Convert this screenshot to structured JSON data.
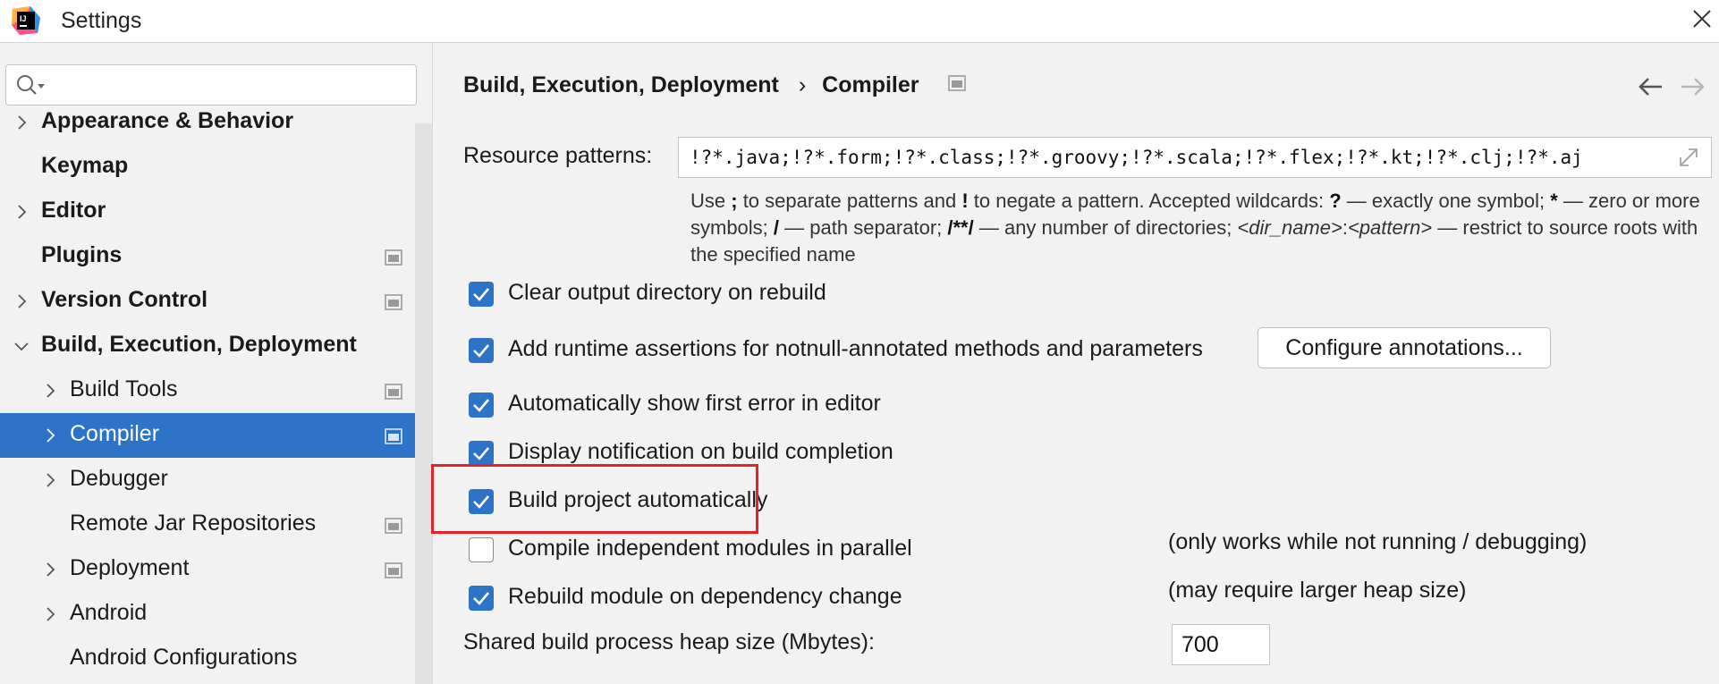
{
  "window": {
    "title": "Settings",
    "app_icon": "intellij-idea-icon",
    "close_icon": "close-icon"
  },
  "search": {
    "value": "",
    "placeholder": ""
  },
  "sidebar": {
    "items": [
      {
        "label": "Appearance & Behavior",
        "bold": true,
        "chevron": "right",
        "project_icon": false
      },
      {
        "label": "Keymap",
        "bold": true,
        "chevron": "none",
        "project_icon": false
      },
      {
        "label": "Editor",
        "bold": true,
        "chevron": "right",
        "project_icon": false
      },
      {
        "label": "Plugins",
        "bold": true,
        "chevron": "none",
        "project_icon": true
      },
      {
        "label": "Version Control",
        "bold": true,
        "chevron": "right",
        "project_icon": true
      },
      {
        "label": "Build, Execution, Deployment",
        "bold": true,
        "chevron": "down",
        "project_icon": false
      },
      {
        "label": "Build Tools",
        "bold": false,
        "chevron": "right",
        "project_icon": true
      },
      {
        "label": "Compiler",
        "bold": false,
        "chevron": "right",
        "project_icon": true,
        "selected": true
      },
      {
        "label": "Debugger",
        "bold": false,
        "chevron": "right",
        "project_icon": false
      },
      {
        "label": "Remote Jar Repositories",
        "bold": false,
        "chevron": "none",
        "project_icon": true
      },
      {
        "label": "Deployment",
        "bold": false,
        "chevron": "right",
        "project_icon": true
      },
      {
        "label": "Android",
        "bold": false,
        "chevron": "right",
        "project_icon": false
      },
      {
        "label": "Android Configurations",
        "bold": false,
        "chevron": "none",
        "project_icon": false
      }
    ]
  },
  "breadcrumb": {
    "parent": "Build, Execution, Deployment",
    "separator": "›",
    "current": "Compiler"
  },
  "resource_patterns": {
    "label": "Resource patterns:",
    "value": "!?*.java;!?*.form;!?*.class;!?*.groovy;!?*.scala;!?*.flex;!?*.kt;!?*.clj;!?*.aj"
  },
  "hint": {
    "t1": "Use ",
    "semi": ";",
    "t2": " to separate patterns and ",
    "bang": "!",
    "t3": " to negate a pattern. Accepted wildcards: ",
    "q": "?",
    "t4": " — exactly one symbol; ",
    "star": "*",
    "t5": " — zero or more symbols; ",
    "slash": "/",
    "t6": " — path separator; ",
    "dstar": "/**/",
    "t7": " — any number of directories; ",
    "dir": "<dir_name>",
    "colon": ":",
    "pat": "<pattern>",
    "t8": " — restrict to source roots with the specified name"
  },
  "options": [
    {
      "label": "Clear output directory on rebuild",
      "checked": true
    },
    {
      "label": "Add runtime assertions for notnull-annotated methods and parameters",
      "checked": true
    },
    {
      "label": "Automatically show first error in editor",
      "checked": true
    },
    {
      "label": "Display notification on build completion",
      "checked": true
    },
    {
      "label": "Build project automatically",
      "checked": true
    },
    {
      "label": "Compile independent modules in parallel",
      "checked": false
    },
    {
      "label": "Rebuild module on dependency change",
      "checked": true
    }
  ],
  "configure_button": "Configure annotations...",
  "notes": {
    "auto_build": "(only works while not running / debugging)",
    "parallel": "(may require larger heap size)"
  },
  "heap": {
    "label": "Shared build process heap size (Mbytes):",
    "value": "700"
  },
  "colors": {
    "accent": "#2d73c7",
    "highlight": "#e3222b",
    "background": "#f2f2f2"
  }
}
